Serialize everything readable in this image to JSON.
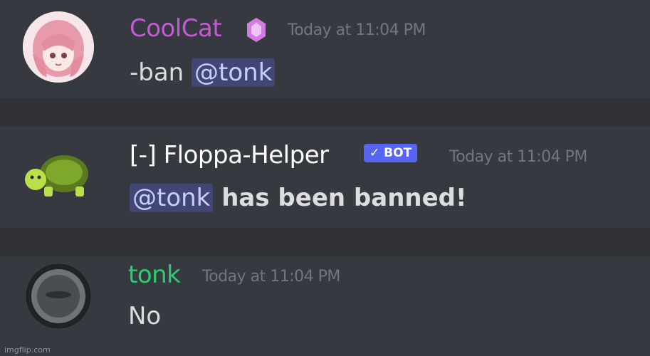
{
  "messages": [
    {
      "username": "CoolCat",
      "timestamp": "Today at 11:04 PM",
      "content_prefix": "-ban ",
      "mention": "@tonk",
      "content_suffix": "",
      "name_color": "#c45ad6",
      "avatar": "anime-girl-avatar",
      "badge": "nitro-gem-icon"
    },
    {
      "username": "[-] Floppa-Helper",
      "bot_tag": "✓ BOT",
      "timestamp": "Today at 11:04 PM",
      "mention": "@tonk",
      "content_suffix": " has been banned!",
      "name_color": "#ffffff",
      "avatar": "turtle-avatar"
    },
    {
      "username": "tonk",
      "timestamp": "Today at 11:04 PM",
      "content": "No",
      "name_color": "#2ecc71",
      "avatar": "gray-circle-avatar"
    }
  ],
  "watermark": "imgflip.com"
}
